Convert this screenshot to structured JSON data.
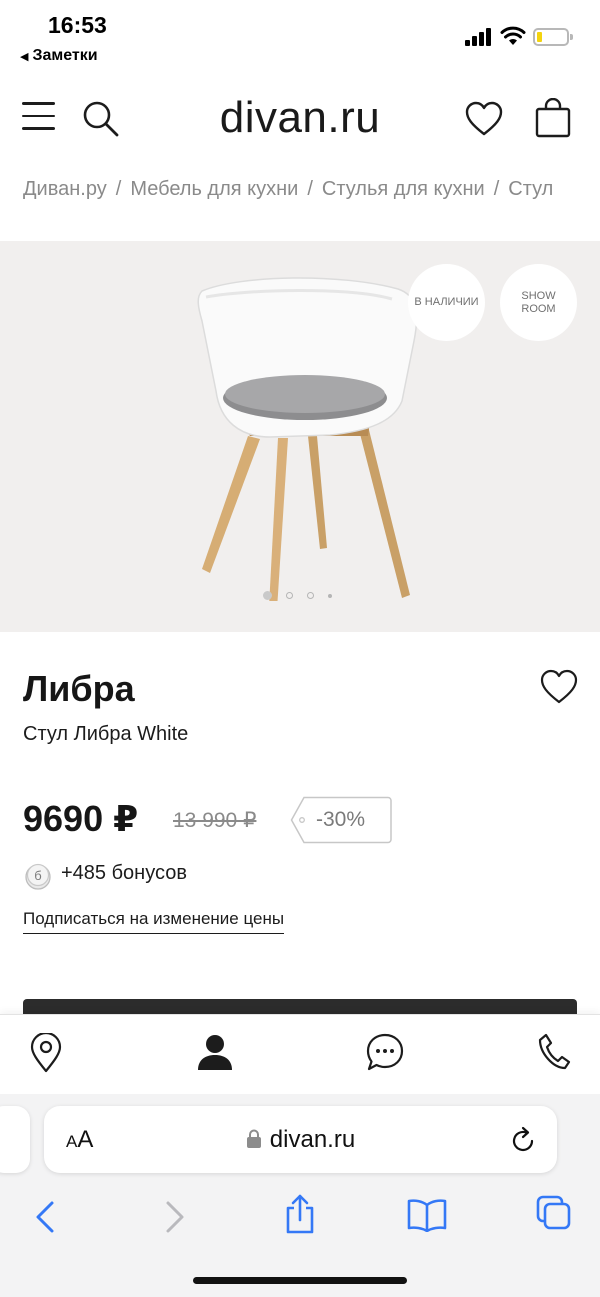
{
  "status_bar": {
    "time": "16:53",
    "back_app": "Заметки"
  },
  "header": {
    "logo": "divan.ru"
  },
  "breadcrumbs": [
    "Диван.ру",
    "Мебель для кухни",
    "Стулья для кухни",
    "Стул"
  ],
  "gallery": {
    "badge_stock": "В НАЛИЧИИ",
    "badge_showroom_line1": "SHOW",
    "badge_showroom_line2": "ROOM",
    "slide_count": 4,
    "active_slide": 1
  },
  "product": {
    "title": "Либра",
    "subtitle": "Стул Либра White",
    "price": "9690 ₽",
    "old_price": "13 990 ₽",
    "discount": "-30%",
    "bonus_icon_letter": "б",
    "bonus": "+485 бонусов",
    "subscribe_link": "Подписаться на изменение цены"
  },
  "tab_bar": {
    "items": [
      "location-pin-icon",
      "user-icon",
      "chat-icon",
      "phone-icon"
    ]
  },
  "safari": {
    "aa_small": "A",
    "aa_large": "A",
    "url": "divan.ru",
    "toolbar": [
      "back-icon",
      "forward-icon",
      "share-icon",
      "bookmarks-icon",
      "tabs-icon"
    ]
  },
  "colors": {
    "gallery_bg": "#f1efee",
    "text": "#1c1c1c",
    "muted": "#8a8a8a",
    "safari_blue": "#3478f6",
    "button_dark": "#2c2c2c"
  }
}
